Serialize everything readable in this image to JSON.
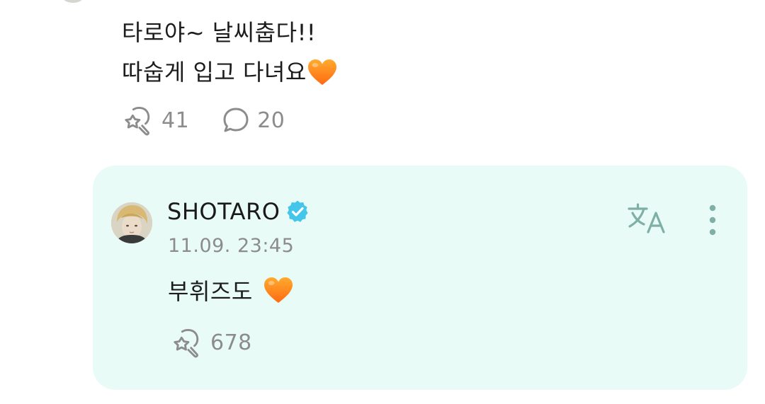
{
  "post": {
    "line1": "타로야~ 날씨춥다!!",
    "line2_text": "따숩게 입고 다녀요",
    "line2_emoji": "orange-heart-emoji",
    "like_count": "41",
    "comment_count": "20"
  },
  "reply": {
    "author": "SHOTARO",
    "verified": true,
    "timestamp": "11.09. 23:45",
    "text": "부휘즈도",
    "text_emoji": "orange-heart-emoji",
    "like_count": "678"
  },
  "icons": {
    "like": "like-icon",
    "comment": "comment-icon",
    "translate": "translate-icon",
    "more": "more-vertical-icon",
    "verified": "verified-badge-icon"
  },
  "colors": {
    "reply_background": "#e9fbf7",
    "accent": "#43c6ea",
    "secondary_text": "#8c8c8c",
    "heart": "#ff8a1c"
  }
}
